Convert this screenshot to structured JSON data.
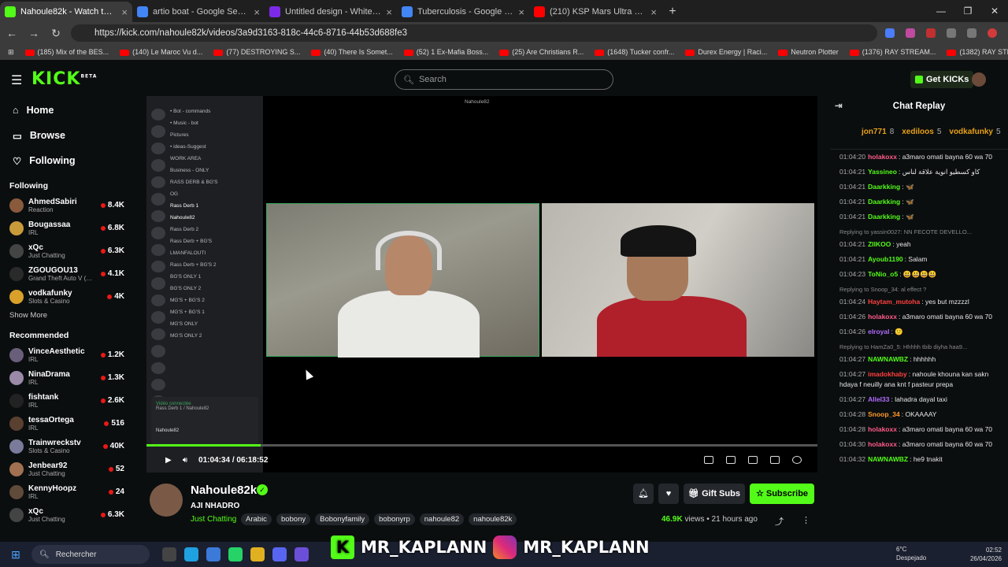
{
  "browser": {
    "tabs": [
      {
        "title": "Nahoule82k - Watch the VO",
        "color": "#53fc18",
        "active": true
      },
      {
        "title": "artio boat - Google Search",
        "color": "#4285f4",
        "active": false
      },
      {
        "title": "Untitled design - Whiteboard",
        "color": "#7d2ae8",
        "active": false
      },
      {
        "title": "Tuberculosis - Google Search",
        "color": "#4285f4",
        "active": false
      },
      {
        "title": "(210) KSP Mars Ultra Direct: Lu",
        "color": "#ff0000",
        "active": false
      }
    ],
    "url": "https://kick.com/nahoule82k/videos/3a9d3163-818c-44c6-8716-44b53d688fe3",
    "bookmarks": [
      "(185) Mix of the BES...",
      "(140) Le Maroc Vu d...",
      "(77) DESTROYING S...",
      "(40) There Is Somet...",
      "(52) 1 Ex-Mafia Boss...",
      "(25) Are Christians R...",
      "(1648) Tucker confr...",
      "Durex Energy | Raci...",
      "Neutron Plotter",
      "(1376) RAY STREAM...",
      "(1382) RAY STREAM..."
    ],
    "bookmarks_all": "Tous les favoris"
  },
  "kick": {
    "logo": "KICK",
    "logo_beta": "BETA",
    "search_placeholder": "Search",
    "get_kicks": "Get KICKs",
    "nav": [
      {
        "label": "Home",
        "icon": "home-icon"
      },
      {
        "label": "Browse",
        "icon": "browse-icon"
      },
      {
        "label": "Following",
        "icon": "heart-icon"
      }
    ],
    "following_header": "Following",
    "following": [
      {
        "name": "AhmedSabiri",
        "cat": "Reaction",
        "viewers": "8.4K",
        "color": "#8a5a3c"
      },
      {
        "name": "Bougassaa",
        "cat": "IRL",
        "viewers": "6.8K",
        "color": "#c89a3a"
      },
      {
        "name": "xQc",
        "cat": "Just Chatting",
        "viewers": "6.3K",
        "color": "#444"
      },
      {
        "name": "ZGOUGOU13",
        "cat": "Grand Theft Auto V (G...",
        "viewers": "4.1K",
        "color": "#2a2a2a"
      },
      {
        "name": "vodkafunky",
        "cat": "Slots & Casino",
        "viewers": "4K",
        "color": "#d9a02a"
      }
    ],
    "show_more": "Show More",
    "recommended_header": "Recommended",
    "recommended": [
      {
        "name": "VinceAesthetic",
        "cat": "IRL",
        "viewers": "1.2K",
        "color": "#6a5f7a"
      },
      {
        "name": "NinaDrama",
        "cat": "IRL",
        "viewers": "1.3K",
        "color": "#9a8aa8"
      },
      {
        "name": "fishtank",
        "cat": "IRL",
        "viewers": "2.6K",
        "color": "#222"
      },
      {
        "name": "tessaOrtega",
        "cat": "IRL",
        "viewers": "516",
        "color": "#5a4030"
      },
      {
        "name": "Trainwreckstv",
        "cat": "Slots & Casino",
        "viewers": "40K",
        "color": "#7a7a9a"
      },
      {
        "name": "Jenbear92",
        "cat": "Just Chatting",
        "viewers": "52",
        "color": "#a07050"
      },
      {
        "name": "KennyHoopz",
        "cat": "IRL",
        "viewers": "24",
        "color": "#604a3a"
      },
      {
        "name": "xQc",
        "cat": "Just Chatting",
        "viewers": "6.3K",
        "color": "#444"
      }
    ]
  },
  "player": {
    "current_time": "01:04:34",
    "duration": "06:18:52",
    "progress": 0.17,
    "discord": {
      "channels": [
        "• Bot - commands",
        "• Music - bot",
        "Pictures",
        "• ideas-Suggest",
        "WORK AREA",
        "Business - ONLY",
        "RASS DERB & BG'S",
        "OG",
        "Rass Derb 1",
        "Nahoule82",
        "Rass Derb 2",
        "Rass Derb + BG'S",
        "LMANFALOUTI",
        "Rass Derb + BG'S 2",
        "BG'S ONLY 1",
        "BG'S ONLY 2",
        "MG'S + BG'S 2",
        "MG'S + BG'S 1",
        "MG'S ONLY",
        "MG'S ONLY 2"
      ],
      "call_status": "Vidéo connectée",
      "call_channel": "Rass Derb 1 / Nahoule82",
      "user": "Nahoule82",
      "window_title": "Nahoule82"
    }
  },
  "video": {
    "channel": "Nahoule82k",
    "title": "AJI NHADRO",
    "category": "Just Chatting",
    "tags": [
      "Arabic",
      "bobony",
      "Bobonyfamily",
      "bobonyrp",
      "nahoule82",
      "nahoule82k"
    ],
    "views": "46.9K",
    "views_label": "views",
    "age": "21 hours ago",
    "gift_subs": "Gift Subs",
    "subscribe": "Subscribe"
  },
  "chat": {
    "title": "Chat Replay",
    "gifters": [
      {
        "name": "jon771",
        "count": "8"
      },
      {
        "name": "xediloos",
        "count": "5"
      },
      {
        "name": "vodkafunky",
        "count": "5"
      }
    ],
    "messages": [
      {
        "ts": "01:04:20",
        "user": "holakoxx",
        "color": "#ff5c8a",
        "text": "a3maro omati bayna 60 wa 70"
      },
      {
        "ts": "01:04:21",
        "user": "Yassineo",
        "color": "#53fc18",
        "text": "كاو كسطيو انوية علاقة لناس"
      },
      {
        "ts": "01:04:21",
        "user": "Daarkking",
        "color": "#53fc18",
        "text": "🦋"
      },
      {
        "ts": "01:04:21",
        "user": "Daarkking",
        "color": "#53fc18",
        "text": "🦋"
      },
      {
        "ts": "01:04:21",
        "user": "Daarkking",
        "color": "#53fc18",
        "text": "🦋"
      },
      {
        "reply": "Replying to yassin0027: NN FECOTE DEVELLO..."
      },
      {
        "ts": "01:04:21",
        "user": "ZIIKOO",
        "color": "#53fc18",
        "text": "yeah"
      },
      {
        "ts": "01:04:21",
        "user": "Ayoub1190",
        "color": "#53fc18",
        "text": "Salam"
      },
      {
        "ts": "01:04:23",
        "user": "ToNio_o5",
        "color": "#53fc18",
        "text": "😃😃😃😃"
      },
      {
        "reply": "Replying to Snoop_34: al effect ?"
      },
      {
        "ts": "01:04:24",
        "user": "Haytam_mutoha",
        "color": "#ff4040",
        "text": "yes but mzzzzl"
      },
      {
        "ts": "01:04:26",
        "user": "holakoxx",
        "color": "#ff5c8a",
        "text": "a3maro omati bayna 60 wa 70"
      },
      {
        "ts": "01:04:26",
        "user": "elroyal",
        "color": "#b06cff",
        "text": "🙂"
      },
      {
        "reply": "Replying to HamZa0_5: Hhhhh tbib diyha haa9..."
      },
      {
        "ts": "01:04:27",
        "user": "NAWNAWBZ",
        "color": "#53fc18",
        "text": "hhhhhh"
      },
      {
        "ts": "01:04:27",
        "user": "imadokhaby",
        "color": "#ff4040",
        "text": "nahoule khouna kan sakn hdaya f neuilly ana knt f pasteur prepa"
      },
      {
        "ts": "01:04:27",
        "user": "Allel33",
        "color": "#b06cff",
        "text": "lahadra dayal taxi"
      },
      {
        "ts": "01:04:28",
        "user": "Snoop_34",
        "color": "#ff9a2a",
        "text": "OKAAAAY"
      },
      {
        "ts": "01:04:28",
        "user": "holakoxx",
        "color": "#ff5c8a",
        "text": "a3maro omati bayna 60 wa 70"
      },
      {
        "ts": "01:04:30",
        "user": "holakoxx",
        "color": "#ff5c8a",
        "text": "a3maro omati bayna 60 wa 70"
      },
      {
        "ts": "01:04:32",
        "user": "NAWNAWBZ",
        "color": "#53fc18",
        "text": "he9 tnakit"
      }
    ]
  },
  "taskbar": {
    "search_placeholder": "Rechercher",
    "weather_temp": "6°C",
    "weather_desc": "Despejado",
    "time": "02:52",
    "date": "26/04/2026",
    "overlay_left": "MR_KAPLANN",
    "overlay_right": "MR_KAPLANN"
  }
}
